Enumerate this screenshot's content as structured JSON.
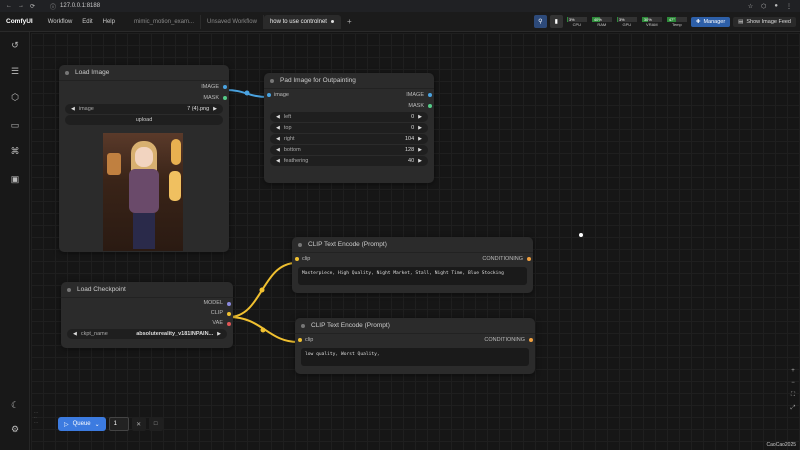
{
  "browser": {
    "url": "127.0.0.1:8188"
  },
  "menubar": {
    "logo": "ComfyUI",
    "menus": [
      "Workflow",
      "Edit",
      "Help"
    ],
    "tabs": [
      {
        "label": "mimic_motion_exam..."
      },
      {
        "label": "Unsaved Workflow"
      },
      {
        "label": "how to use controlnet"
      }
    ],
    "plus": "+",
    "stats": [
      {
        "label": "CPU",
        "value": "3%",
        "fill": 0.03
      },
      {
        "label": "RAM",
        "value": "40%",
        "fill": 0.4
      },
      {
        "label": "GPU",
        "value": "3%",
        "fill": 0.03
      },
      {
        "label": "VRAM",
        "value": "30%",
        "fill": 0.3
      },
      {
        "label": "Temp",
        "value": "47°",
        "fill": 0.47
      }
    ],
    "manager_label": "Manager",
    "feed_label": "Show Image Feed"
  },
  "nodes": {
    "load_image": {
      "title": "Load Image",
      "outputs": [
        "IMAGE",
        "MASK"
      ],
      "image_widget": {
        "label": "image",
        "value": "7 (4).png"
      },
      "upload_label": "upload"
    },
    "pad_image": {
      "title": "Pad Image for Outpainting",
      "input": "image",
      "outputs": [
        "IMAGE",
        "MASK"
      ],
      "widgets": [
        {
          "label": "left",
          "value": "0"
        },
        {
          "label": "top",
          "value": "0"
        },
        {
          "label": "right",
          "value": "104"
        },
        {
          "label": "bottom",
          "value": "128"
        },
        {
          "label": "feathering",
          "value": "40"
        }
      ]
    },
    "clip_pos": {
      "title": "CLIP Text Encode (Prompt)",
      "input": "clip",
      "output": "CONDITIONING",
      "text": "Masterpiece, High Quality, Night Market, Stall, Night Time, Blue Stocking"
    },
    "clip_neg": {
      "title": "CLIP Text Encode (Prompt)",
      "input": "clip",
      "output": "CONDITIONING",
      "text": "low quality, Worst Quality,"
    },
    "checkpoint": {
      "title": "Load Checkpoint",
      "outputs": [
        "MODEL",
        "CLIP",
        "VAE"
      ],
      "widget": {
        "label": "ckpt_name",
        "value": "absolutereality_v181INPAIN..."
      }
    }
  },
  "queue": {
    "label": "Queue",
    "count": "1"
  },
  "watermark": "CaoCao2025",
  "colors": {
    "image_link": "#4aa3e0",
    "clip_link": "#f0c030",
    "mask_dot": "#55cc88",
    "model_dot": "#8a8ae0",
    "vae_dot": "#e05555",
    "conditioning_dot": "#f0a040",
    "accent": "#3c7be0"
  }
}
